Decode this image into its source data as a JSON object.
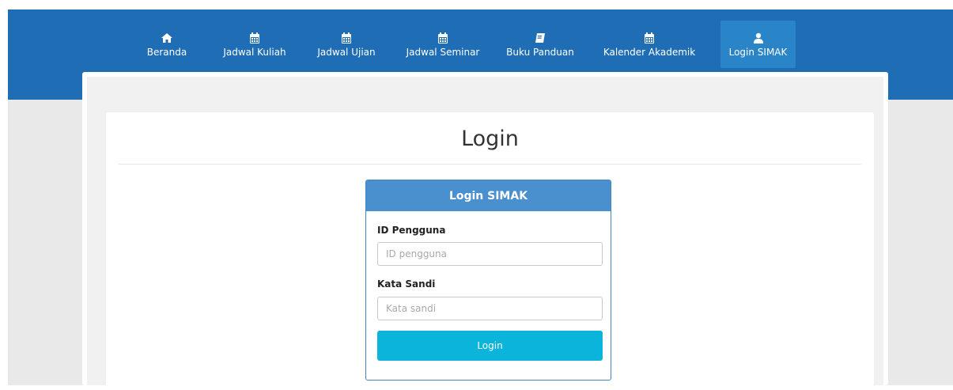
{
  "nav": {
    "items": [
      {
        "label": "Beranda",
        "icon": "home-icon"
      },
      {
        "label": "Jadwal Kuliah",
        "icon": "calendar-icon"
      },
      {
        "label": "Jadwal Ujian",
        "icon": "calendar-icon"
      },
      {
        "label": "Jadwal Seminar",
        "icon": "calendar-icon"
      },
      {
        "label": "Buku Panduan",
        "icon": "book-icon"
      },
      {
        "label": "Kalender Akademik",
        "icon": "calendar-icon"
      },
      {
        "label": "Login SIMAK",
        "icon": "user-icon",
        "active": true
      }
    ]
  },
  "page": {
    "title": "Login"
  },
  "login": {
    "header": "Login SIMAK",
    "user_label": "ID Pengguna",
    "user_placeholder": "ID pengguna",
    "password_label": "Kata Sandi",
    "password_placeholder": "Kata sandi",
    "button_label": "Login"
  },
  "colors": {
    "topbar": "#1f6eb5",
    "nav_active": "#2a84c8",
    "login_header": "#4a90cf",
    "login_button": "#0ab4db"
  }
}
